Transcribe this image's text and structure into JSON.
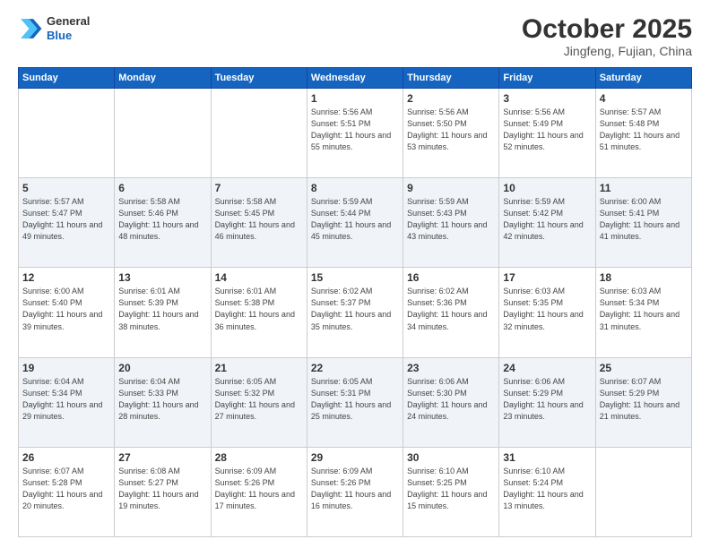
{
  "header": {
    "logo_line1": "General",
    "logo_line2": "Blue",
    "month": "October 2025",
    "location": "Jingfeng, Fujian, China"
  },
  "days_of_week": [
    "Sunday",
    "Monday",
    "Tuesday",
    "Wednesday",
    "Thursday",
    "Friday",
    "Saturday"
  ],
  "weeks": [
    [
      {
        "day": "",
        "info": ""
      },
      {
        "day": "",
        "info": ""
      },
      {
        "day": "",
        "info": ""
      },
      {
        "day": "1",
        "info": "Sunrise: 5:56 AM\nSunset: 5:51 PM\nDaylight: 11 hours\nand 55 minutes."
      },
      {
        "day": "2",
        "info": "Sunrise: 5:56 AM\nSunset: 5:50 PM\nDaylight: 11 hours\nand 53 minutes."
      },
      {
        "day": "3",
        "info": "Sunrise: 5:56 AM\nSunset: 5:49 PM\nDaylight: 11 hours\nand 52 minutes."
      },
      {
        "day": "4",
        "info": "Sunrise: 5:57 AM\nSunset: 5:48 PM\nDaylight: 11 hours\nand 51 minutes."
      }
    ],
    [
      {
        "day": "5",
        "info": "Sunrise: 5:57 AM\nSunset: 5:47 PM\nDaylight: 11 hours\nand 49 minutes."
      },
      {
        "day": "6",
        "info": "Sunrise: 5:58 AM\nSunset: 5:46 PM\nDaylight: 11 hours\nand 48 minutes."
      },
      {
        "day": "7",
        "info": "Sunrise: 5:58 AM\nSunset: 5:45 PM\nDaylight: 11 hours\nand 46 minutes."
      },
      {
        "day": "8",
        "info": "Sunrise: 5:59 AM\nSunset: 5:44 PM\nDaylight: 11 hours\nand 45 minutes."
      },
      {
        "day": "9",
        "info": "Sunrise: 5:59 AM\nSunset: 5:43 PM\nDaylight: 11 hours\nand 43 minutes."
      },
      {
        "day": "10",
        "info": "Sunrise: 5:59 AM\nSunset: 5:42 PM\nDaylight: 11 hours\nand 42 minutes."
      },
      {
        "day": "11",
        "info": "Sunrise: 6:00 AM\nSunset: 5:41 PM\nDaylight: 11 hours\nand 41 minutes."
      }
    ],
    [
      {
        "day": "12",
        "info": "Sunrise: 6:00 AM\nSunset: 5:40 PM\nDaylight: 11 hours\nand 39 minutes."
      },
      {
        "day": "13",
        "info": "Sunrise: 6:01 AM\nSunset: 5:39 PM\nDaylight: 11 hours\nand 38 minutes."
      },
      {
        "day": "14",
        "info": "Sunrise: 6:01 AM\nSunset: 5:38 PM\nDaylight: 11 hours\nand 36 minutes."
      },
      {
        "day": "15",
        "info": "Sunrise: 6:02 AM\nSunset: 5:37 PM\nDaylight: 11 hours\nand 35 minutes."
      },
      {
        "day": "16",
        "info": "Sunrise: 6:02 AM\nSunset: 5:36 PM\nDaylight: 11 hours\nand 34 minutes."
      },
      {
        "day": "17",
        "info": "Sunrise: 6:03 AM\nSunset: 5:35 PM\nDaylight: 11 hours\nand 32 minutes."
      },
      {
        "day": "18",
        "info": "Sunrise: 6:03 AM\nSunset: 5:34 PM\nDaylight: 11 hours\nand 31 minutes."
      }
    ],
    [
      {
        "day": "19",
        "info": "Sunrise: 6:04 AM\nSunset: 5:34 PM\nDaylight: 11 hours\nand 29 minutes."
      },
      {
        "day": "20",
        "info": "Sunrise: 6:04 AM\nSunset: 5:33 PM\nDaylight: 11 hours\nand 28 minutes."
      },
      {
        "day": "21",
        "info": "Sunrise: 6:05 AM\nSunset: 5:32 PM\nDaylight: 11 hours\nand 27 minutes."
      },
      {
        "day": "22",
        "info": "Sunrise: 6:05 AM\nSunset: 5:31 PM\nDaylight: 11 hours\nand 25 minutes."
      },
      {
        "day": "23",
        "info": "Sunrise: 6:06 AM\nSunset: 5:30 PM\nDaylight: 11 hours\nand 24 minutes."
      },
      {
        "day": "24",
        "info": "Sunrise: 6:06 AM\nSunset: 5:29 PM\nDaylight: 11 hours\nand 23 minutes."
      },
      {
        "day": "25",
        "info": "Sunrise: 6:07 AM\nSunset: 5:29 PM\nDaylight: 11 hours\nand 21 minutes."
      }
    ],
    [
      {
        "day": "26",
        "info": "Sunrise: 6:07 AM\nSunset: 5:28 PM\nDaylight: 11 hours\nand 20 minutes."
      },
      {
        "day": "27",
        "info": "Sunrise: 6:08 AM\nSunset: 5:27 PM\nDaylight: 11 hours\nand 19 minutes."
      },
      {
        "day": "28",
        "info": "Sunrise: 6:09 AM\nSunset: 5:26 PM\nDaylight: 11 hours\nand 17 minutes."
      },
      {
        "day": "29",
        "info": "Sunrise: 6:09 AM\nSunset: 5:26 PM\nDaylight: 11 hours\nand 16 minutes."
      },
      {
        "day": "30",
        "info": "Sunrise: 6:10 AM\nSunset: 5:25 PM\nDaylight: 11 hours\nand 15 minutes."
      },
      {
        "day": "31",
        "info": "Sunrise: 6:10 AM\nSunset: 5:24 PM\nDaylight: 11 hours\nand 13 minutes."
      },
      {
        "day": "",
        "info": ""
      }
    ]
  ]
}
